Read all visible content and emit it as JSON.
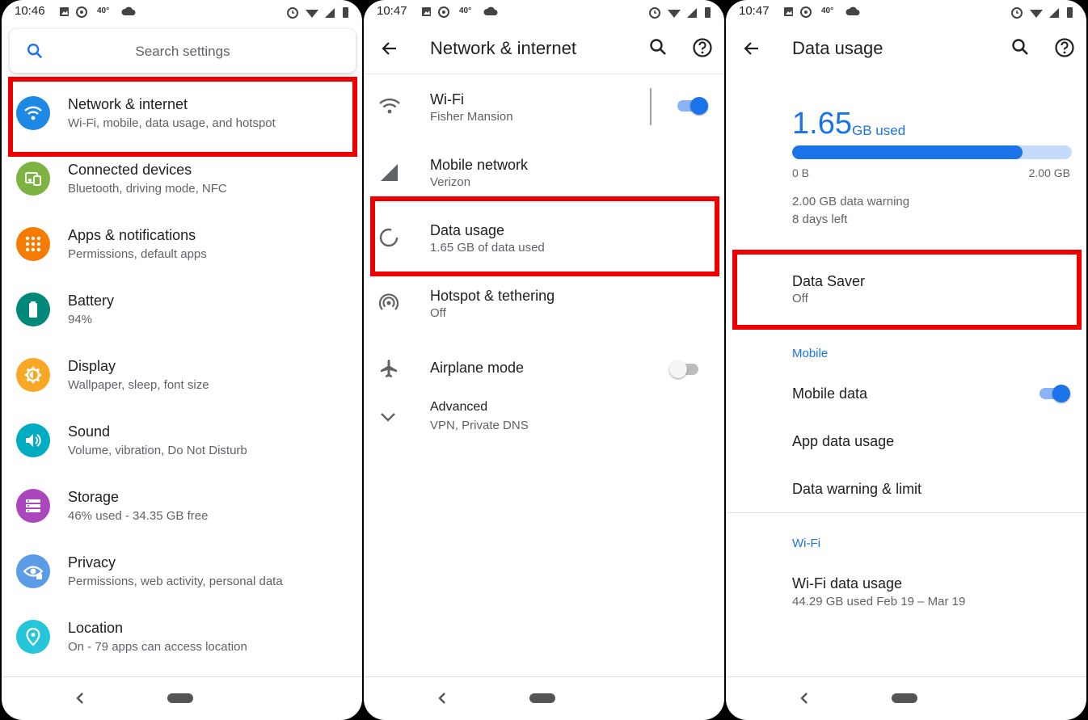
{
  "panels": [
    {
      "time": "10:46",
      "temp": "40°",
      "search_placeholder": "Search settings",
      "items": [
        {
          "title": "Network & internet",
          "subtitle": "Wi-Fi, mobile, data usage, and hotspot",
          "color": "#1e88e5",
          "icon": "wifi-icon"
        },
        {
          "title": "Connected devices",
          "subtitle": "Bluetooth, driving mode, NFC",
          "color": "#7cb342",
          "icon": "devices-icon"
        },
        {
          "title": "Apps & notifications",
          "subtitle": "Permissions, default apps",
          "color": "#f57c00",
          "icon": "apps-grid-icon"
        },
        {
          "title": "Battery",
          "subtitle": "94%",
          "color": "#00897b",
          "icon": "battery-icon"
        },
        {
          "title": "Display",
          "subtitle": "Wallpaper, sleep, font size",
          "color": "#f9a825",
          "icon": "brightness-icon"
        },
        {
          "title": "Sound",
          "subtitle": "Volume, vibration, Do Not Disturb",
          "color": "#00acc1",
          "icon": "volume-icon"
        },
        {
          "title": "Storage",
          "subtitle": "46% used - 34.35 GB free",
          "color": "#ab47bc",
          "icon": "storage-icon"
        },
        {
          "title": "Privacy",
          "subtitle": "Permissions, web activity, personal data",
          "color": "#5c9ce6",
          "icon": "privacy-eye-icon"
        },
        {
          "title": "Location",
          "subtitle": "On - 79 apps can access location",
          "color": "#26c6da",
          "icon": "location-pin-icon"
        }
      ]
    },
    {
      "time": "10:47",
      "temp": "40°",
      "title": "Network & internet",
      "items": [
        {
          "title": "Wi-Fi",
          "subtitle": "Fisher Mansion",
          "icon": "wifi-icon",
          "toggle": "on"
        },
        {
          "title": "Mobile network",
          "subtitle": "Verizon",
          "icon": "signal-icon"
        },
        {
          "title": "Data usage",
          "subtitle": "1.65 GB of data used",
          "icon": "data-usage-icon"
        },
        {
          "title": "Hotspot & tethering",
          "subtitle": "Off",
          "icon": "hotspot-icon"
        },
        {
          "title": "Airplane mode",
          "subtitle": "",
          "icon": "airplane-icon",
          "toggle": "off"
        },
        {
          "title": "Advanced",
          "subtitle": "VPN, Private DNS",
          "icon": "chevron-down-icon"
        }
      ]
    },
    {
      "time": "10:47",
      "temp": "40°",
      "title": "Data usage",
      "usage_value": "1.65",
      "usage_unit": "GB used",
      "usage_fraction": 0.825,
      "bar_min": "0 B",
      "bar_max": "2.00 GB",
      "warning": "2.00 GB data warning",
      "days_left": "8 days left",
      "data_saver": {
        "title": "Data Saver",
        "subtitle": "Off"
      },
      "mobile_header": "Mobile",
      "mobile_data": "Mobile data",
      "app_data_usage": "App data usage",
      "data_warning_limit": "Data warning & limit",
      "wifi_header": "Wi-Fi",
      "wifi_data_usage": "Wi-Fi data usage",
      "wifi_usage_sub": "44.29 GB used Feb 19 – Mar 19"
    }
  ],
  "colors": {
    "accent": "#1a73e8",
    "highlight": "#ee0000"
  }
}
